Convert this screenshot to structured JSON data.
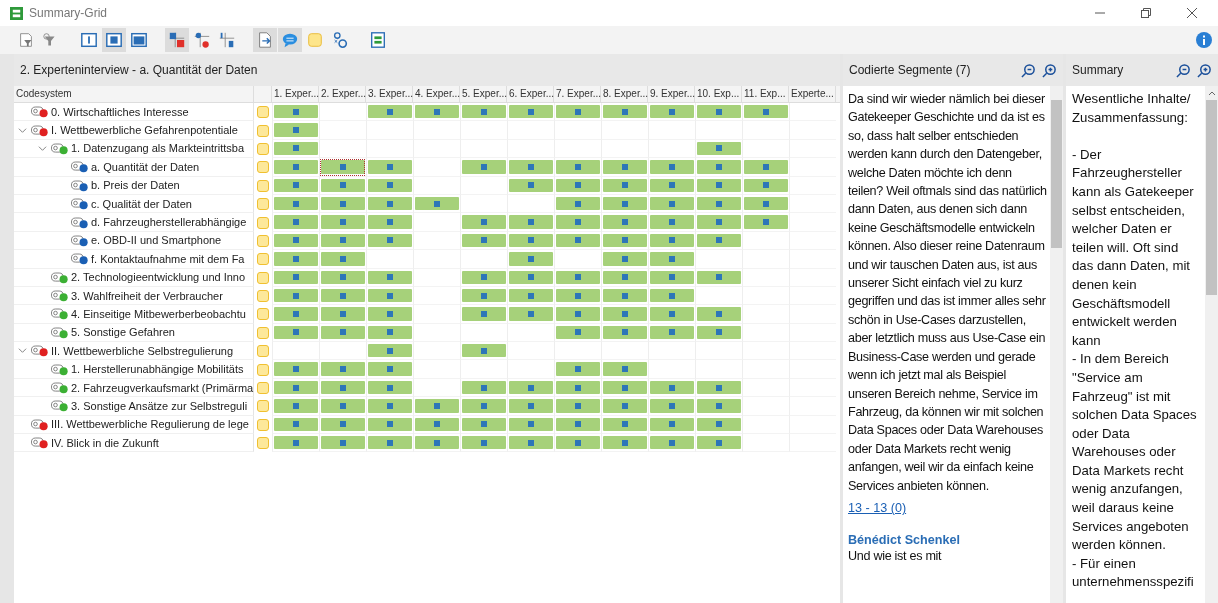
{
  "window": {
    "title": "Summary-Grid"
  },
  "toolbar": [
    {
      "kind": "filter",
      "selected": false
    },
    {
      "kind": "filter-alt",
      "selected": false
    },
    {
      "kind": "layout-a",
      "selected": false
    },
    {
      "kind": "layout-b",
      "selected": true
    },
    {
      "kind": "layout-c",
      "selected": false
    },
    {
      "kind": "grid-square",
      "selected": true
    },
    {
      "kind": "grid-dot",
      "selected": false
    },
    {
      "kind": "grid-number",
      "selected": false
    },
    {
      "kind": "document",
      "selected": true
    },
    {
      "kind": "comment",
      "selected": true
    },
    {
      "kind": "memo",
      "selected": false
    },
    {
      "kind": "text-a",
      "selected": false
    },
    {
      "kind": "summary",
      "selected": false
    }
  ],
  "grid": {
    "title": "2. Experteninterview - a. Quantität der Daten",
    "tree_heading": "Codesystem",
    "columns": [
      "1. Exper...",
      "2. Exper...",
      "3. Exper...",
      "4. Exper...",
      "5. Exper...",
      "6. Exper...",
      "7. Exper...",
      "8. Exper...",
      "9. Exper...",
      "10. Exp...",
      "11. Exp...",
      "Experte..."
    ],
    "codes": [
      {
        "label": "0. Wirtschaftliches Interesse",
        "color": "#e02020",
        "coded": [
          true,
          false,
          true,
          true,
          true,
          true,
          true,
          true,
          true,
          true,
          true,
          false
        ],
        "selected": [
          false,
          false,
          false,
          false,
          false,
          false,
          false,
          false,
          false,
          false,
          false,
          false
        ]
      },
      {
        "label": "I. Wettbewerbliche Gefahrenpotentiale",
        "color": "#e02020",
        "expanded": true,
        "coded": [
          true,
          false,
          false,
          false,
          false,
          false,
          false,
          false,
          false,
          false,
          false,
          false
        ],
        "selected": [
          false,
          false,
          false,
          false,
          false,
          false,
          false,
          false,
          false,
          false,
          false,
          false
        ],
        "children": [
          {
            "label": "1. Datenzugang als Markteintrittsba",
            "color": "#3cb034",
            "expanded": true,
            "coded": [
              true,
              false,
              false,
              false,
              false,
              false,
              false,
              false,
              false,
              true,
              false,
              false
            ],
            "selected": [
              false,
              false,
              false,
              false,
              false,
              false,
              false,
              false,
              false,
              false,
              false,
              false
            ],
            "children": [
              {
                "label": "a. Quantität der Daten",
                "color": "#1a5fb4",
                "coded": [
                  true,
                  true,
                  true,
                  false,
                  true,
                  true,
                  true,
                  true,
                  true,
                  true,
                  true,
                  false
                ],
                "selected": [
                  false,
                  true,
                  false,
                  false,
                  false,
                  false,
                  false,
                  false,
                  false,
                  false,
                  false,
                  false
                ]
              },
              {
                "label": "b. Preis der Daten",
                "color": "#1a5fb4",
                "coded": [
                  true,
                  true,
                  true,
                  false,
                  false,
                  true,
                  true,
                  true,
                  true,
                  true,
                  true,
                  false
                ],
                "selected": [
                  false,
                  false,
                  false,
                  false,
                  false,
                  false,
                  false,
                  false,
                  false,
                  false,
                  false,
                  false
                ]
              },
              {
                "label": "c. Qualität der Daten",
                "color": "#1a5fb4",
                "coded": [
                  true,
                  true,
                  true,
                  true,
                  false,
                  false,
                  true,
                  true,
                  true,
                  true,
                  true,
                  false
                ],
                "selected": [
                  false,
                  false,
                  false,
                  false,
                  false,
                  false,
                  false,
                  false,
                  false,
                  false,
                  false,
                  false
                ]
              },
              {
                "label": "d. Fahrzeugherstellerabhängige",
                "color": "#1a5fb4",
                "coded": [
                  true,
                  true,
                  true,
                  false,
                  true,
                  true,
                  true,
                  true,
                  true,
                  true,
                  true,
                  false
                ],
                "selected": [
                  false,
                  false,
                  false,
                  false,
                  false,
                  false,
                  false,
                  false,
                  false,
                  false,
                  false,
                  false
                ]
              },
              {
                "label": "e. OBD-II und Smartphone",
                "color": "#1a5fb4",
                "coded": [
                  true,
                  true,
                  true,
                  false,
                  true,
                  true,
                  true,
                  true,
                  true,
                  true,
                  false,
                  false
                ],
                "selected": [
                  false,
                  false,
                  false,
                  false,
                  false,
                  false,
                  false,
                  false,
                  false,
                  false,
                  false,
                  false
                ]
              },
              {
                "label": "f. Kontaktaufnahme mit dem Fa",
                "color": "#1a5fb4",
                "coded": [
                  true,
                  true,
                  false,
                  false,
                  false,
                  true,
                  false,
                  true,
                  true,
                  false,
                  false,
                  false
                ],
                "selected": [
                  false,
                  false,
                  false,
                  false,
                  false,
                  false,
                  false,
                  false,
                  false,
                  false,
                  false,
                  false
                ]
              }
            ]
          },
          {
            "label": "2. Technologieentwicklung und Inno",
            "color": "#3cb034",
            "coded": [
              true,
              true,
              true,
              false,
              true,
              true,
              true,
              true,
              true,
              true,
              false,
              false
            ],
            "selected": [
              false,
              false,
              false,
              false,
              false,
              false,
              false,
              false,
              false,
              false,
              false,
              false
            ]
          },
          {
            "label": "3. Wahlfreiheit der Verbraucher",
            "color": "#3cb034",
            "coded": [
              true,
              true,
              true,
              false,
              true,
              true,
              true,
              true,
              true,
              false,
              false,
              false
            ],
            "selected": [
              false,
              false,
              false,
              false,
              false,
              false,
              false,
              false,
              false,
              false,
              false,
              false
            ]
          },
          {
            "label": "4. Einseitige Mitbewerberbeobachtu",
            "color": "#3cb034",
            "coded": [
              true,
              true,
              true,
              false,
              true,
              true,
              true,
              true,
              true,
              true,
              false,
              false
            ],
            "selected": [
              false,
              false,
              false,
              false,
              false,
              false,
              false,
              false,
              false,
              false,
              false,
              false
            ]
          },
          {
            "label": "5. Sonstige Gefahren",
            "color": "#3cb034",
            "coded": [
              true,
              true,
              true,
              false,
              false,
              false,
              true,
              true,
              true,
              true,
              false,
              false
            ],
            "selected": [
              false,
              false,
              false,
              false,
              false,
              false,
              false,
              false,
              false,
              false,
              false,
              false
            ]
          }
        ]
      },
      {
        "label": "II. Wettbewerbliche Selbstregulierung",
        "color": "#e02020",
        "expanded": true,
        "coded": [
          false,
          false,
          true,
          false,
          true,
          false,
          false,
          false,
          false,
          false,
          false,
          false
        ],
        "selected": [
          false,
          false,
          false,
          false,
          false,
          false,
          false,
          false,
          false,
          false,
          false,
          false
        ],
        "children": [
          {
            "label": "1. Herstellerunabhängige Mobilitäts",
            "color": "#3cb034",
            "coded": [
              true,
              true,
              true,
              false,
              false,
              false,
              true,
              true,
              false,
              false,
              false,
              false
            ],
            "selected": [
              false,
              false,
              false,
              false,
              false,
              false,
              false,
              false,
              false,
              false,
              false,
              false
            ]
          },
          {
            "label": "2. Fahrzeugverkaufsmarkt (Primärma",
            "color": "#3cb034",
            "coded": [
              true,
              true,
              true,
              false,
              true,
              true,
              true,
              true,
              true,
              true,
              false,
              false
            ],
            "selected": [
              false,
              false,
              false,
              false,
              false,
              false,
              false,
              false,
              false,
              false,
              false,
              false
            ]
          },
          {
            "label": "3. Sonstige Ansätze zur Selbstreguli",
            "color": "#3cb034",
            "coded": [
              true,
              true,
              true,
              true,
              true,
              true,
              true,
              true,
              true,
              true,
              false,
              false
            ],
            "selected": [
              false,
              false,
              false,
              false,
              false,
              false,
              false,
              false,
              false,
              false,
              false,
              false
            ]
          }
        ]
      },
      {
        "label": "III. Wettbewerbliche Regulierung de lege",
        "color": "#e02020",
        "coded": [
          true,
          true,
          true,
          true,
          true,
          true,
          true,
          true,
          true,
          true,
          false,
          false
        ],
        "selected": [
          false,
          false,
          false,
          false,
          false,
          false,
          false,
          false,
          false,
          false,
          false,
          false
        ]
      },
      {
        "label": "IV. Blick in die Zukunft",
        "color": "#e02020",
        "coded": [
          true,
          true,
          true,
          true,
          true,
          true,
          true,
          true,
          true,
          true,
          false,
          false
        ],
        "selected": [
          false,
          false,
          false,
          false,
          false,
          false,
          false,
          false,
          false,
          false,
          false,
          false
        ]
      }
    ]
  },
  "segments": {
    "title": "Codierte Segmente (7)",
    "items": [
      {
        "text": "Da sind wir wieder nämlich bei dieser Gatekeeper Geschichte und da ist es so, dass halt selber entschieden werden kann durch den Datengeber, welche Daten möchte ich denn teilen? Weil oftmals sind das natürlich dann Daten, aus denen sich dann keine Geschäftsmodelle entwickeln können. Also dieser reine Datenraum und wir tauschen Daten aus, ist aus unserer Sicht einfach viel zu kurz gegriffen und das ist immer alles sehr schön in Use-Cases darzustellen, aber letztlich muss aus Use-Case ein Business-Case werden und gerade wenn ich jetzt mal als Beispiel unseren Bereich nehme, Service im Fahrzeug, da können wir mit solchen Data Spaces oder Data Warehouses oder Data Markets recht wenig anfangen, weil wir da einfach keine Services anbieten können.",
        "reference": "13 - 13  (0)"
      },
      {
        "speaker": "Bénédict Schenkel",
        "text": "Und wie ist es mit"
      }
    ]
  },
  "summary": {
    "title": "Summary",
    "text": "Wesentliche Inhalte/ Zusammenfassung:\n\n- Der Fahrzeughersteller kann als Gatekeeper selbst entscheiden, welcher Daten er teilen will. Oft sind das dann Daten, mit denen kein Geschäftsmodell entwickelt werden kann\n- In dem Bereich \"Service am Fahrzeug\" ist mit solchen Data Spaces oder Data Warehouses oder Data Markets recht wenig anzufangen, weil daraus keine Services angeboten werden können.\n- Für einen unternehmensspezifi"
  }
}
